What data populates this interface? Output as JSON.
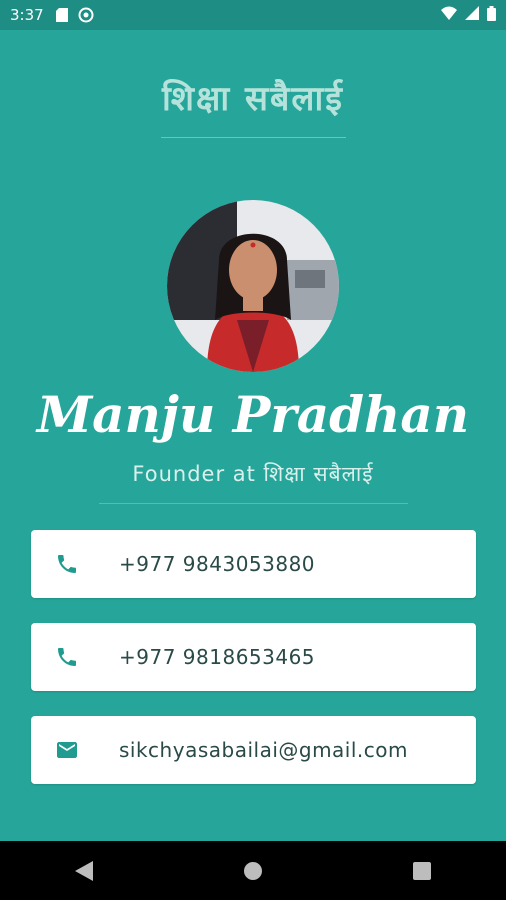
{
  "status_bar": {
    "time": "3:37",
    "icons": [
      "sd-card-icon",
      "sync-icon",
      "wifi-icon",
      "signal-icon",
      "battery-icon"
    ]
  },
  "header": {
    "app_title": "शिक्षा सबैलाई"
  },
  "profile": {
    "avatar_alt": "profile-photo",
    "name": "Manju Pradhan",
    "subtitle": "Founder at  शिक्षा  सबैलाई"
  },
  "contacts": [
    {
      "type": "phone",
      "icon": "phone-icon",
      "value": "+977  9843053880"
    },
    {
      "type": "phone",
      "icon": "phone-icon",
      "value": "+977  9818653465"
    },
    {
      "type": "email",
      "icon": "email-icon",
      "value": "sikchyasabailai@gmail.com"
    }
  ],
  "navigation": {
    "buttons": [
      "back",
      "home",
      "recents"
    ]
  },
  "colors": {
    "background": "#26A69A",
    "status_bar": "#1E8D83",
    "card": "#FFFFFF",
    "icon": "#1F9C8F",
    "nav_bar": "#000000"
  }
}
